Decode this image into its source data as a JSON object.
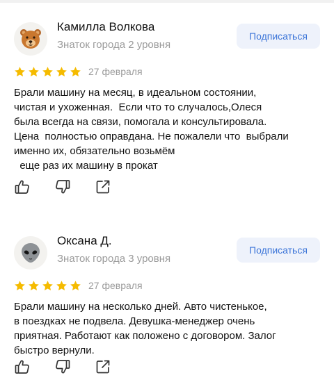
{
  "reviews": [
    {
      "author": "Камилла Волкова",
      "level": "Знаток города 2 уровня",
      "subscribe_label": "Подписаться",
      "avatar_icon": "bear-face-icon",
      "rating": 5,
      "date": "27 февраля",
      "text_lines": [
        "Брали машину на месяц, в идеальном состоянии,",
        "чистая и ухоженная.  Если что то случалось,Олеся",
        "была всегда на связи, помогала и консультировала.",
        "Цена  полностью оправдана. Не пожалели что  выбрали",
        "именно их, обязательно возьмём",
        "  еще раз их машину в прокат"
      ]
    },
    {
      "author": "Оксана Д.",
      "level": "Знаток города 3 уровня",
      "subscribe_label": "Подписаться",
      "avatar_icon": "alien-face-icon",
      "rating": 5,
      "date": "27 февраля",
      "text_lines": [
        "Брали машину на несколько дней. Авто чистенькое,",
        "в поездках не подвела. Девушка-менеджер очень",
        "приятная. Работают как положено с договором. Залог",
        "быстро вернули."
      ]
    }
  ],
  "colors": {
    "star": "#f5bb00",
    "subscribe_bg": "#eef2fb",
    "subscribe_text": "#3b74d8",
    "muted_text": "#9b9b9b"
  }
}
